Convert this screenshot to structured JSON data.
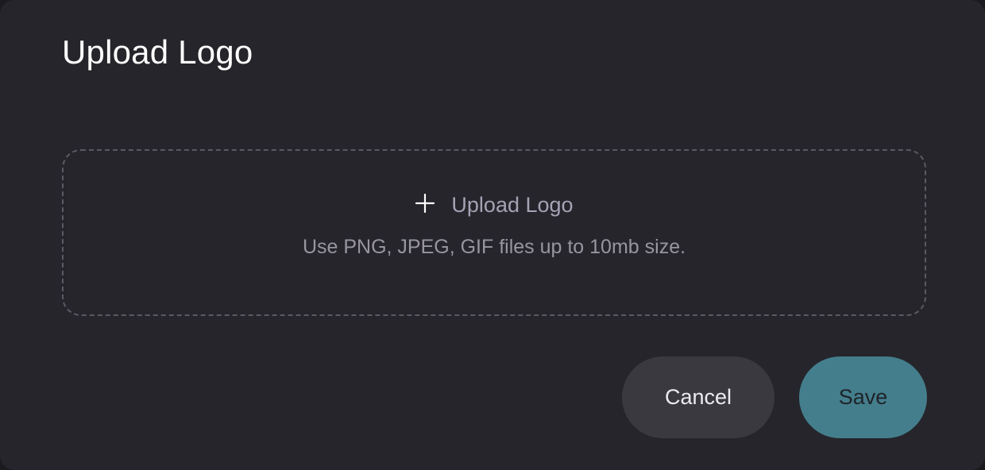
{
  "dialog": {
    "title": "Upload Logo"
  },
  "dropzone": {
    "icon": "plus-icon",
    "label": "Upload Logo",
    "hint": "Use PNG, JPEG, GIF files up to 10mb size."
  },
  "actions": {
    "cancel_label": "Cancel",
    "save_label": "Save"
  },
  "colors": {
    "background": "#25252b",
    "save_button": "#447e8c",
    "cancel_button": "#3a393f",
    "dropzone_border": "#5a5a62"
  }
}
